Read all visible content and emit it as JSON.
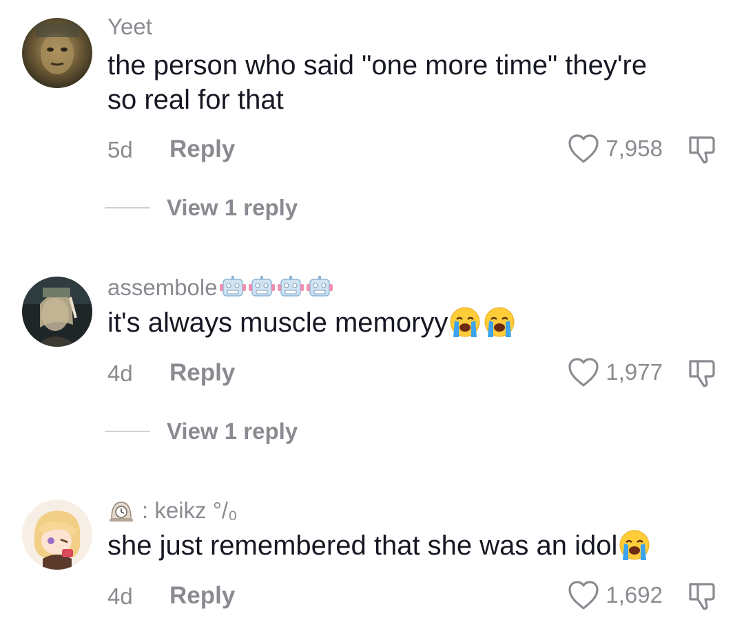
{
  "comments": [
    {
      "username": "Yeet",
      "text_lines": [
        "the person who said \"one more time\" they're",
        "so real for that"
      ],
      "time": "5d",
      "reply_label": "Reply",
      "likes": "7,958",
      "view_replies": "View 1 reply"
    },
    {
      "username": "assembole",
      "username_emoji": [
        "robot-emoji",
        "robot-emoji",
        "robot-emoji",
        "robot-emoji"
      ],
      "text": "it's always muscle memoryy",
      "text_emoji": [
        "loudly-crying-face-emoji",
        "loudly-crying-face-emoji"
      ],
      "time": "4d",
      "reply_label": "Reply",
      "likes": "1,977",
      "view_replies": "View 1 reply"
    },
    {
      "username_prefix_icon": "mantelpiece-clock-emoji",
      "username": ": keikz °/₀",
      "text": "she just remembered that she was an idol",
      "text_emoji": [
        "loudly-crying-face-emoji"
      ],
      "time": "4d",
      "reply_label": "Reply",
      "likes": "1,692"
    }
  ],
  "colors": {
    "muted": "#8a8b91",
    "text": "#161823",
    "divider": "#d0d0d3"
  }
}
